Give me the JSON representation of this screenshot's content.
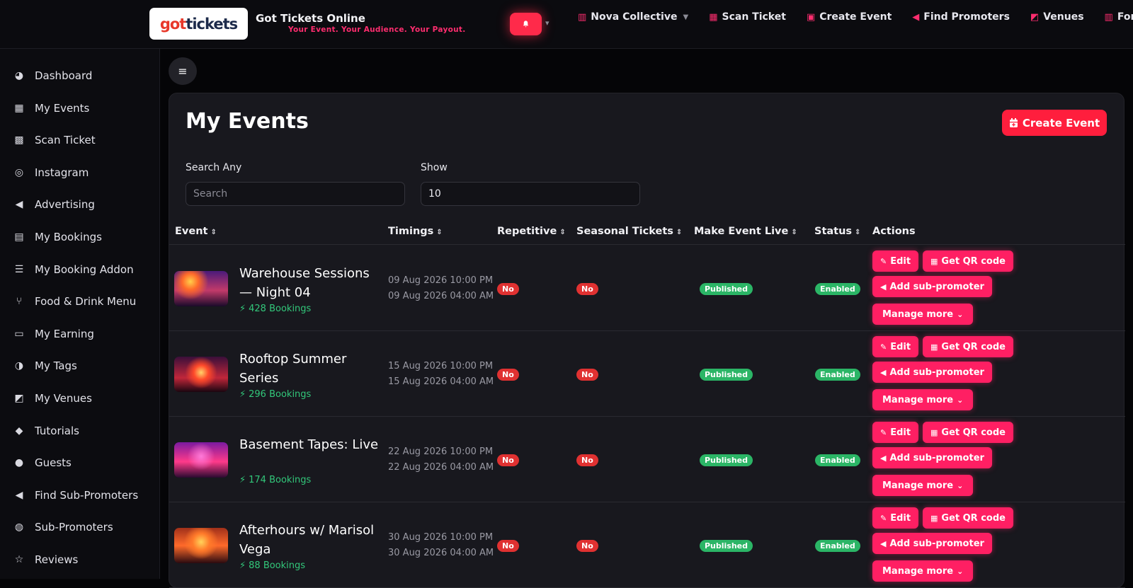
{
  "header": {
    "logo_text_a": "got",
    "logo_text_b": "tickets",
    "title": "Got Tickets Online",
    "tagline": "Your Event. Your Audience. Your Payout.",
    "nav": [
      {
        "label": "Nova Collective",
        "icon": "building-icon",
        "dropdown": true
      },
      {
        "label": "Scan Ticket",
        "icon": "qr-icon"
      },
      {
        "label": "Create Event",
        "icon": "calendar-plus-icon"
      },
      {
        "label": "Find Promoters",
        "icon": "megaphone-icon"
      },
      {
        "label": "Venues",
        "icon": "map-icon"
      },
      {
        "label": "For V",
        "icon": "building-icon"
      }
    ],
    "accent": "#ff2d6f"
  },
  "sidebar": {
    "items": [
      {
        "label": "Dashboard",
        "icon": "dashboard-icon"
      },
      {
        "label": "My Events",
        "icon": "calendar-icon"
      },
      {
        "label": "Scan Ticket",
        "icon": "qr-icon"
      },
      {
        "label": "Instagram",
        "icon": "instagram-icon"
      },
      {
        "label": "Advertising",
        "icon": "megaphone-icon"
      },
      {
        "label": "My Bookings",
        "icon": "id-card-icon"
      },
      {
        "label": "My Booking Addon",
        "icon": "list-icon"
      },
      {
        "label": "Food & Drink Menu",
        "icon": "utensils-icon"
      },
      {
        "label": "My Earning",
        "icon": "wallet-icon"
      },
      {
        "label": "My Tags",
        "icon": "user-tag-icon"
      },
      {
        "label": "My Venues",
        "icon": "map-icon"
      },
      {
        "label": "Tutorials",
        "icon": "graduation-cap-icon"
      },
      {
        "label": "Guests",
        "icon": "users-icon"
      },
      {
        "label": "Find Sub-Promoters",
        "icon": "megaphone-icon"
      },
      {
        "label": "Sub-Promoters",
        "icon": "user-group-icon"
      },
      {
        "label": "Reviews",
        "icon": "star-icon"
      }
    ]
  },
  "main": {
    "title": "My Events",
    "create_button": "Create Event",
    "search_label": "Search Any",
    "search_placeholder": "Search",
    "show_label": "Show",
    "show_value": "10",
    "columns": [
      "Event",
      "Timings",
      "Repetitive",
      "Seasonal Tickets",
      "Make Event Live",
      "Status",
      "Actions"
    ],
    "actions": {
      "edit": "Edit",
      "qr": "Get QR code",
      "sub": "Add sub-promoter",
      "more": "Manage more"
    },
    "events": [
      {
        "name": "Warehouse Sessions — Night 04",
        "bookings": "428 Bookings",
        "start": "09 Aug 2026 10:00 PM",
        "end": "09 Aug 2026 04:00 AM",
        "repetitive": "No",
        "seasonal": "No",
        "live": "Published",
        "status": "Enabled"
      },
      {
        "name": "Rooftop Summer Series",
        "bookings": "296 Bookings",
        "start": "15 Aug 2026 10:00 PM",
        "end": "15 Aug 2026 04:00 AM",
        "repetitive": "No",
        "seasonal": "No",
        "live": "Published",
        "status": "Enabled"
      },
      {
        "name": "Basement Tapes: Live",
        "bookings": "174 Bookings",
        "start": "22 Aug 2026 10:00 PM",
        "end": "22 Aug 2026 04:00 AM",
        "repetitive": "No",
        "seasonal": "No",
        "live": "Published",
        "status": "Enabled"
      },
      {
        "name": "Afterhours w/ Marisol Vega",
        "bookings": "88 Bookings",
        "start": "30 Aug 2026 10:00 PM",
        "end": "30 Aug 2026 04:00 AM",
        "repetitive": "No",
        "seasonal": "No",
        "live": "Published",
        "status": "Enabled"
      }
    ]
  }
}
